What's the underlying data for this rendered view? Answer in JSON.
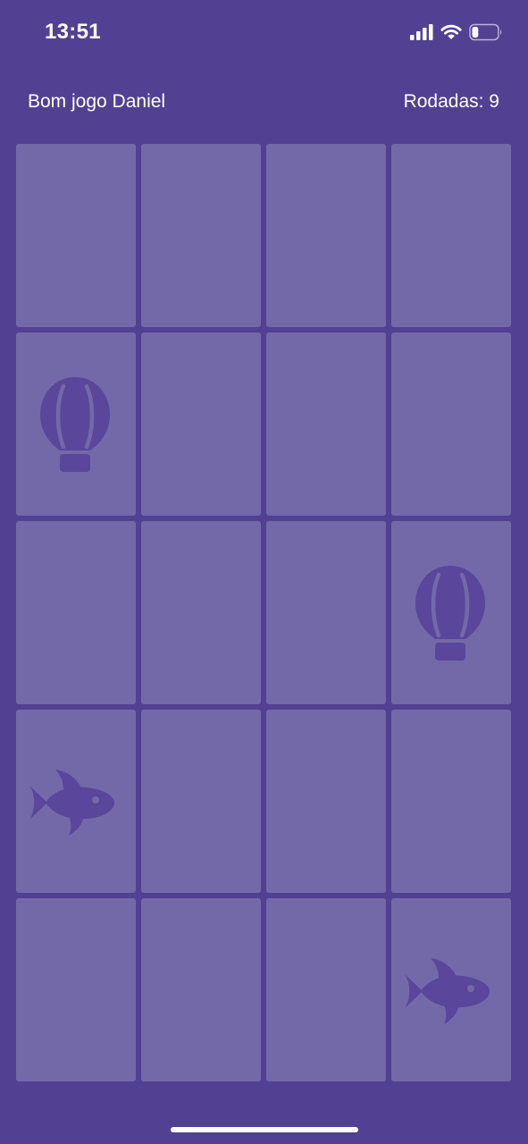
{
  "status_bar": {
    "time": "13:51",
    "icons": [
      "signal-icon",
      "wifi-icon",
      "battery-icon"
    ],
    "battery_level": 0.25
  },
  "header": {
    "greeting": "Bom jogo Daniel",
    "rounds_label": "Rodadas: 9"
  },
  "colors": {
    "background": "#524192",
    "card": "#7369a9",
    "icon": "#5a469a",
    "text": "#ffffff"
  },
  "board": {
    "columns": 4,
    "rows": 5,
    "cards": [
      {
        "state": "hidden",
        "icon": ""
      },
      {
        "state": "hidden",
        "icon": ""
      },
      {
        "state": "hidden",
        "icon": ""
      },
      {
        "state": "hidden",
        "icon": ""
      },
      {
        "state": "revealed",
        "icon": "hot-air-balloon-icon"
      },
      {
        "state": "hidden",
        "icon": ""
      },
      {
        "state": "hidden",
        "icon": ""
      },
      {
        "state": "hidden",
        "icon": ""
      },
      {
        "state": "hidden",
        "icon": ""
      },
      {
        "state": "hidden",
        "icon": ""
      },
      {
        "state": "hidden",
        "icon": ""
      },
      {
        "state": "revealed",
        "icon": "hot-air-balloon-icon"
      },
      {
        "state": "revealed",
        "icon": "fish-icon"
      },
      {
        "state": "hidden",
        "icon": ""
      },
      {
        "state": "hidden",
        "icon": ""
      },
      {
        "state": "hidden",
        "icon": ""
      },
      {
        "state": "hidden",
        "icon": ""
      },
      {
        "state": "hidden",
        "icon": ""
      },
      {
        "state": "hidden",
        "icon": ""
      },
      {
        "state": "revealed",
        "icon": "fish-icon"
      }
    ]
  }
}
